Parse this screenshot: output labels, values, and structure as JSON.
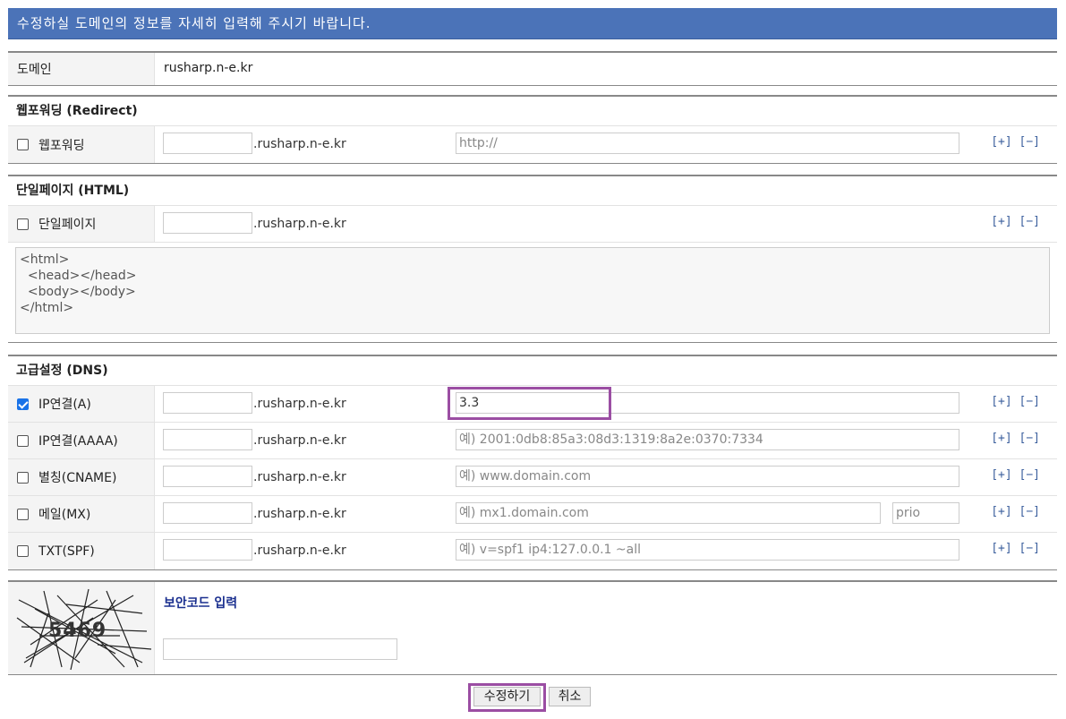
{
  "header": {
    "title": "수정하실 도메인의 정보를 자세히 입력해 주시기 바랍니다."
  },
  "domain_row": {
    "label": "도메인",
    "value": "rusharp.n-e.kr"
  },
  "redirect": {
    "title": "웹포워딩 (Redirect)",
    "row": {
      "label": "웹포워딩",
      "checked": false,
      "subdomain": "",
      "suffix": ".rusharp.n-e.kr",
      "target_placeholder": "http://",
      "plus": "[+]",
      "minus": "[−]"
    }
  },
  "html_page": {
    "title": "단일페이지 (HTML)",
    "row": {
      "label": "단일페이지",
      "checked": false,
      "subdomain": "",
      "suffix": ".rusharp.n-e.kr",
      "plus": "[+]",
      "minus": "[−]"
    },
    "content": "<html>\n  <head></head>\n  <body></body>\n</html>"
  },
  "dns": {
    "title": "고급설정 (DNS)",
    "rows": [
      {
        "label": "IP연결(A)",
        "checked": true,
        "suffix": ".rusharp.n-e.kr",
        "value": "3.3",
        "placeholder": "",
        "plus": "[+]",
        "minus": "[−]"
      },
      {
        "label": "IP연결(AAAA)",
        "checked": false,
        "suffix": ".rusharp.n-e.kr",
        "value": "",
        "placeholder": "예) 2001:0db8:85a3:08d3:1319:8a2e:0370:7334",
        "plus": "[+]",
        "minus": "[−]"
      },
      {
        "label": "별칭(CNAME)",
        "checked": false,
        "suffix": ".rusharp.n-e.kr",
        "value": "",
        "placeholder": "예) www.domain.com",
        "plus": "[+]",
        "minus": "[−]"
      },
      {
        "label": "메일(MX)",
        "checked": false,
        "suffix": ".rusharp.n-e.kr",
        "value": "",
        "placeholder": "예) mx1.domain.com",
        "prio_placeholder": "prio",
        "plus": "[+]",
        "minus": "[−]"
      },
      {
        "label": "TXT(SPF)",
        "checked": false,
        "suffix": ".rusharp.n-e.kr",
        "value": "",
        "placeholder": "예) v=spf1 ip4:127.0.0.1 ~all",
        "plus": "[+]",
        "minus": "[−]"
      }
    ]
  },
  "security": {
    "label": "보안코드 입력",
    "captcha_text": "5469",
    "input_value": ""
  },
  "buttons": {
    "submit": "수정하기",
    "cancel": "취소"
  },
  "colors": {
    "header_bg": "#4b73b8",
    "highlight": "#9b4ea3",
    "link": "#3b5f9d",
    "security_label": "#1a2f8f"
  }
}
